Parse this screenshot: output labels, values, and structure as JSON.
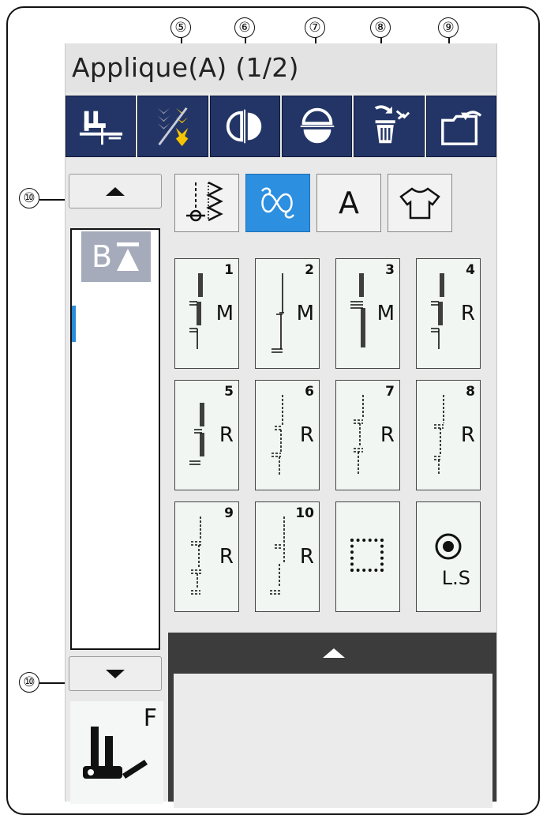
{
  "screen_title": "Applique(A) (1/2)",
  "callouts": {
    "c5": "⑤",
    "c6": "⑥",
    "c7": "⑦",
    "c8": "⑧",
    "c9": "⑨",
    "c10_top": "⑩",
    "c10_bottom": "⑩"
  },
  "toolbar": [
    {
      "name": "needle-setup-icon"
    },
    {
      "name": "elongation-icon"
    },
    {
      "name": "mirror-image-vertical-icon"
    },
    {
      "name": "mirror-image-horizontal-icon"
    },
    {
      "name": "delete-icon"
    },
    {
      "name": "file-open-icon"
    }
  ],
  "side_panel": {
    "top_chip_label": "B"
  },
  "categories": [
    {
      "name": "utility-stitch-icon"
    },
    {
      "name": "decorative-stitch-icon",
      "active": true
    },
    {
      "name": "letter-a-icon",
      "label": "A"
    },
    {
      "name": "garment-icon"
    }
  ],
  "stitches": [
    {
      "num": "1",
      "letter": "M"
    },
    {
      "num": "2",
      "letter": "M"
    },
    {
      "num": "3",
      "letter": "M"
    },
    {
      "num": "4",
      "letter": "R"
    },
    {
      "num": "5",
      "letter": "R"
    },
    {
      "num": "6",
      "letter": "R"
    },
    {
      "num": "7",
      "letter": "R"
    },
    {
      "num": "8",
      "letter": "R"
    },
    {
      "num": "9",
      "letter": "R"
    },
    {
      "num": "10",
      "letter": "R"
    },
    {
      "num": "",
      "letter": ""
    },
    {
      "num": "",
      "letter": "L.S"
    }
  ],
  "foot_label": "F",
  "colors": {
    "toolbar_bg": "#233566",
    "active_blue": "#2c8fe0",
    "accent_yellow": "#f5c400"
  }
}
